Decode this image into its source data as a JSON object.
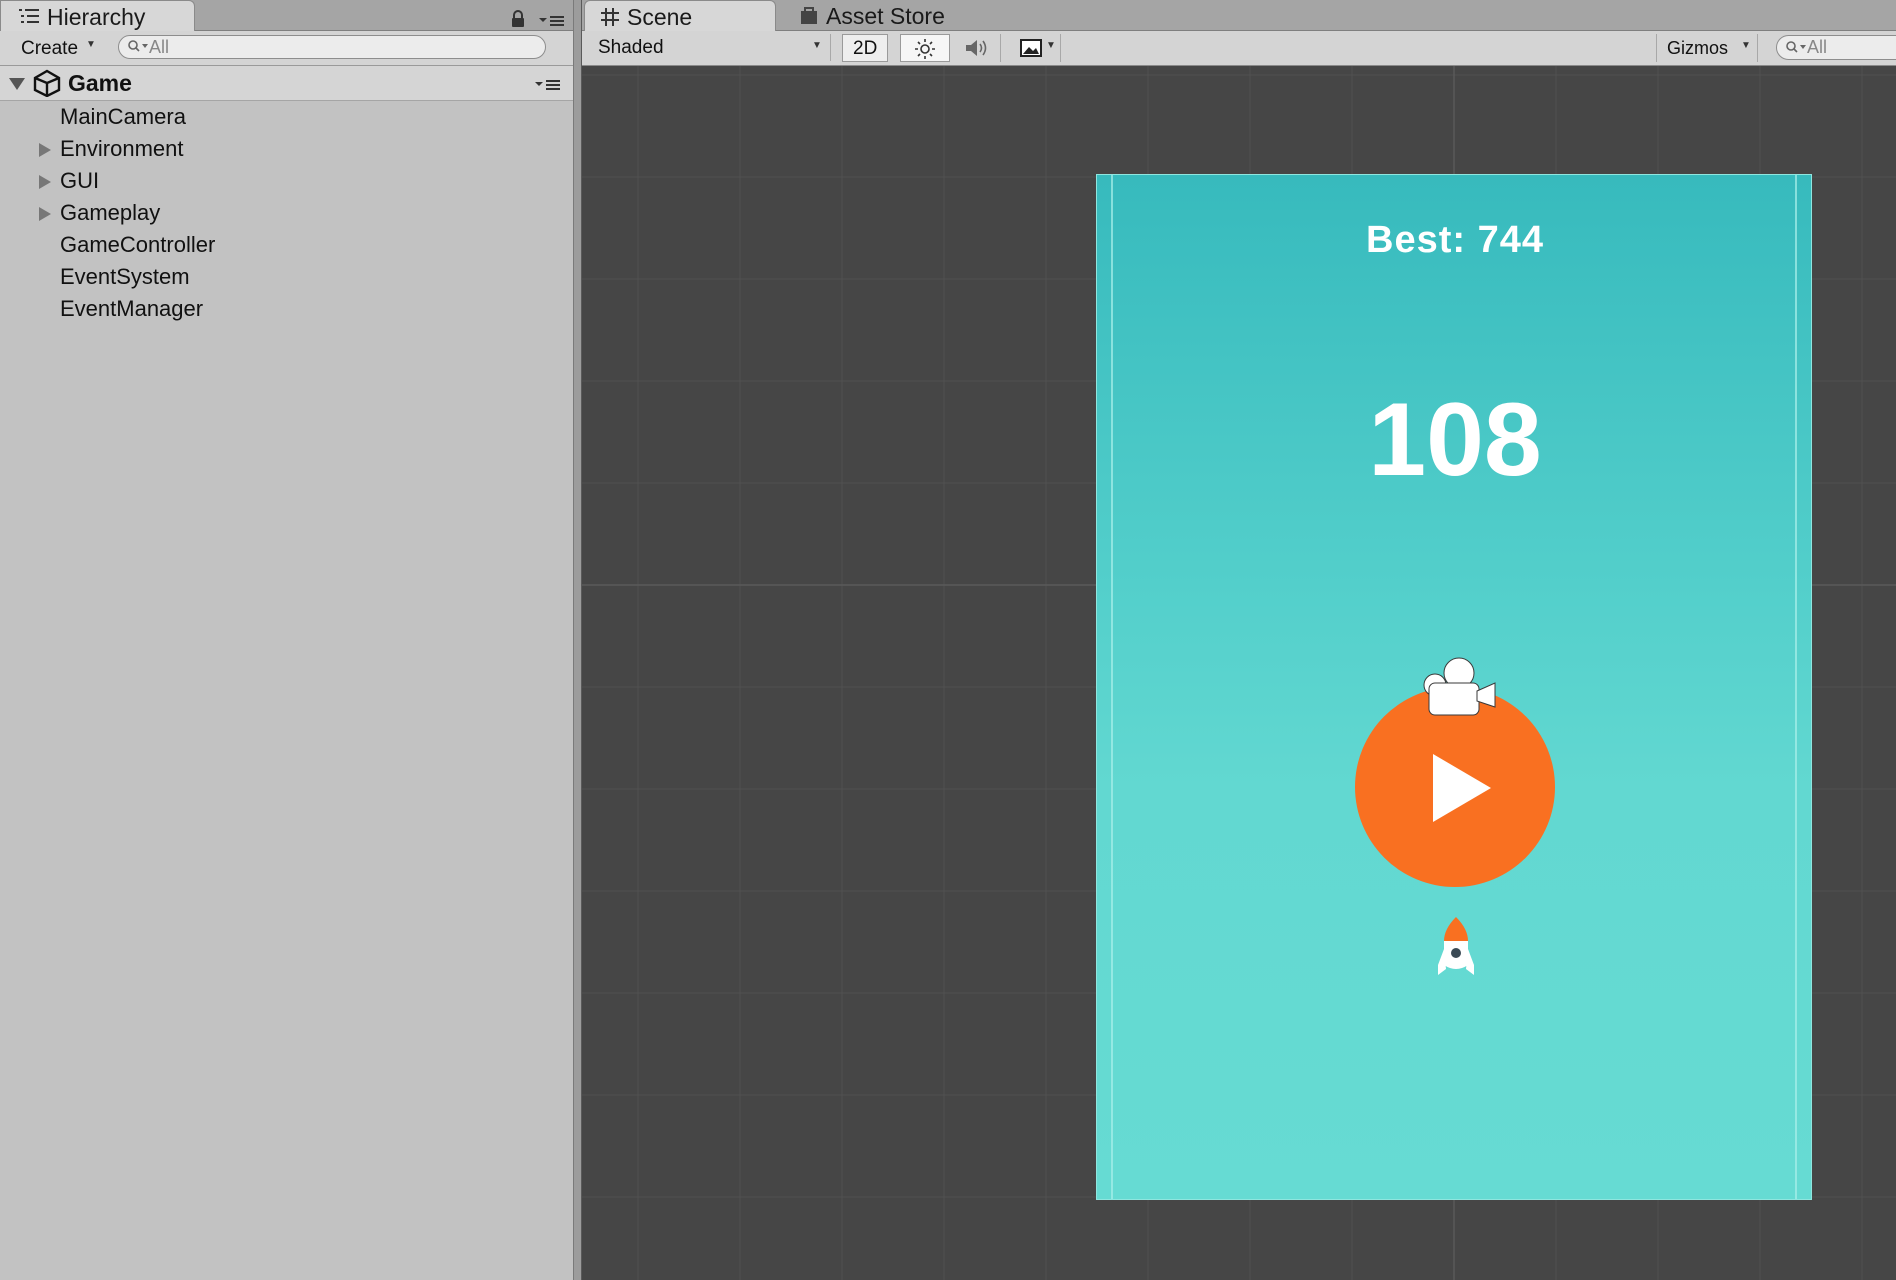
{
  "hierarchy": {
    "tab_label": "Hierarchy",
    "create_label": "Create",
    "search_placeholder": "All",
    "scene_name": "Game",
    "items": [
      {
        "label": "MainCamera",
        "expandable": false
      },
      {
        "label": "Environment",
        "expandable": true
      },
      {
        "label": "GUI",
        "expandable": true
      },
      {
        "label": "Gameplay",
        "expandable": true
      },
      {
        "label": "GameController",
        "expandable": false
      },
      {
        "label": "EventSystem",
        "expandable": false
      },
      {
        "label": "EventManager",
        "expandable": false
      }
    ]
  },
  "scene": {
    "tabs": [
      {
        "label": "Scene",
        "icon": "grid-icon",
        "active": true
      },
      {
        "label": "Asset Store",
        "icon": "shopping-bag-icon",
        "active": false
      }
    ],
    "toolbar": {
      "shading_mode": "Shaded",
      "mode_2d_label": "2D",
      "gizmos_label": "Gizmos",
      "search_placeholder": "All"
    },
    "game": {
      "best_label": "Best: 744",
      "score": "108",
      "colors": {
        "background_top": "#37babd",
        "background_bottom": "#66dbd3",
        "play_button": "#f97021",
        "text": "#ffffff"
      }
    }
  }
}
